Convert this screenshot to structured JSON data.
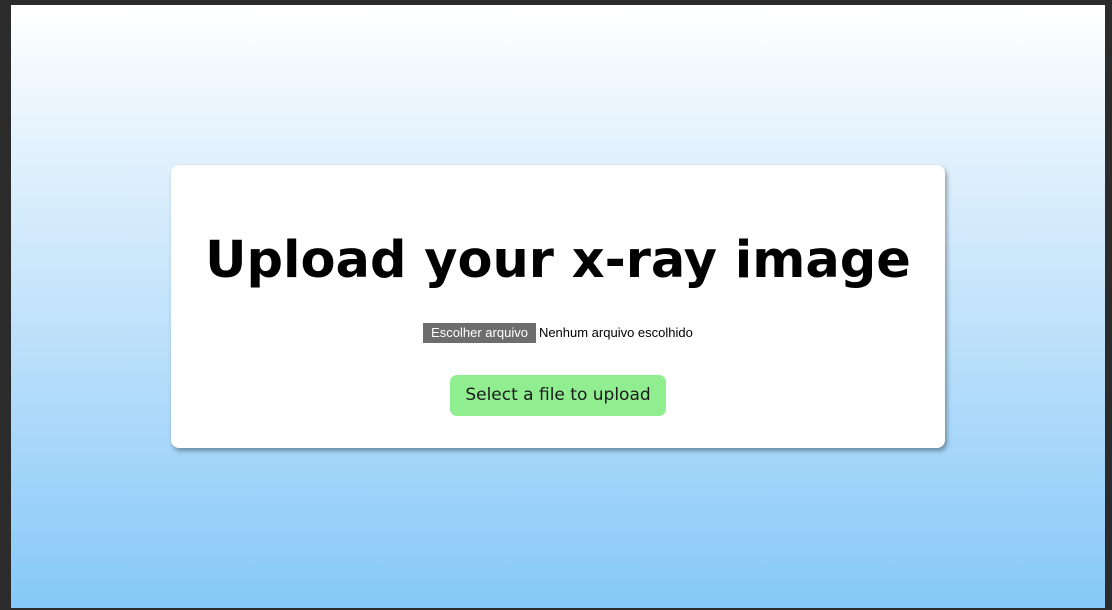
{
  "page": {
    "title": "Upload your x-ray image"
  },
  "file_input": {
    "button_label": "Escolher arquivo",
    "status_text": "Nenhum arquivo escolhido"
  },
  "upload": {
    "button_label": "Select a file to upload"
  },
  "colors": {
    "gradient_top": "#ffffff",
    "gradient_bottom": "#86c8f8",
    "upload_button": "#90ee90",
    "file_button": "#6d6d6d"
  }
}
